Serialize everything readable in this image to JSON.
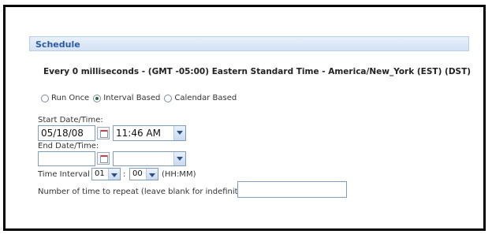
{
  "section": {
    "title": "Schedule"
  },
  "summary": "Every 0 milliseconds - (GMT -05:00) Eastern Standard Time - America/New_York (EST) (DST)",
  "schedule_types": [
    {
      "label": "Run Once",
      "selected": false
    },
    {
      "label": "Interval Based",
      "selected": true
    },
    {
      "label": "Calendar Based",
      "selected": false
    }
  ],
  "start": {
    "label": "Start Date/Time:",
    "date": "05/18/08",
    "time": "11:46 AM"
  },
  "end": {
    "label": "End Date/Time:",
    "date": "",
    "time": ""
  },
  "interval": {
    "label": "Time Interval",
    "hours": "01",
    "separator": ":",
    "minutes": "00",
    "format": "(HH:MM)"
  },
  "repeat": {
    "label": "Number of time to repeat (leave blank for indefinitely)",
    "value": ""
  }
}
